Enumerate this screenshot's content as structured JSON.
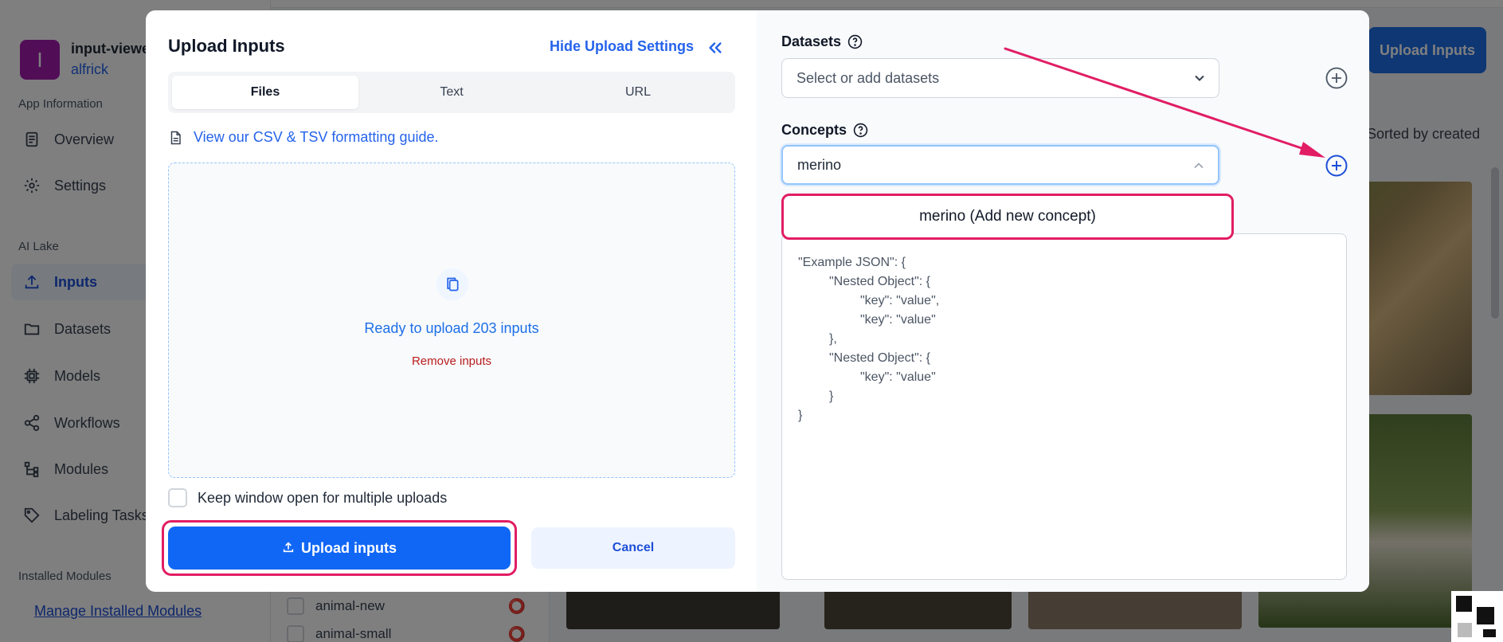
{
  "background": {
    "app": {
      "initial": "I",
      "name": "input-viewe",
      "user": "alfrick"
    },
    "sidebar": {
      "sections": {
        "app_info": "App Information",
        "ai_lake": "AI Lake",
        "installed": "Installed Modules"
      },
      "items": [
        {
          "label": "Overview",
          "icon": "document-icon"
        },
        {
          "label": "Settings",
          "icon": "gear-icon"
        },
        {
          "label": "Inputs",
          "icon": "upload-icon"
        },
        {
          "label": "Datasets",
          "icon": "folder-icon"
        },
        {
          "label": "Models",
          "icon": "chip-icon"
        },
        {
          "label": "Workflows",
          "icon": "share-nodes-icon"
        },
        {
          "label": "Modules",
          "icon": "tree-icon"
        },
        {
          "label": "Labeling Tasks",
          "icon": "tag-icon"
        }
      ],
      "manage_link": "Manage Installed Modules"
    },
    "list_items": [
      "animal-new",
      "animal-small"
    ],
    "top_button": "Upload Inputs",
    "sorted_text": "Sorted by created"
  },
  "modal": {
    "title": "Upload Inputs",
    "hide_settings": "Hide Upload Settings",
    "tabs": [
      "Files",
      "Text",
      "URL"
    ],
    "active_tab": "Files",
    "guide_link": "View our CSV & TSV formatting guide.",
    "dropzone": {
      "ready": "Ready to upload 203 inputs",
      "remove": "Remove inputs"
    },
    "keep_open_label": "Keep window open for multiple uploads",
    "upload_button": "Upload inputs",
    "cancel_button": "Cancel",
    "datasets": {
      "label": "Datasets",
      "placeholder": "Select or add datasets"
    },
    "concepts": {
      "label": "Concepts",
      "value": "merino",
      "option": "merino (Add new concept)"
    },
    "json_lines": [
      "\"Example JSON\": {",
      "\"Nested Object\": {",
      "\"key\": \"value\",",
      "\"key\": \"value\"",
      "},",
      "\"Nested Object\": {",
      "\"key\": \"value\"",
      "}",
      "}"
    ]
  },
  "colors": {
    "accent": "#1167f5",
    "highlight": "#e11d63",
    "link": "#2563eb"
  }
}
